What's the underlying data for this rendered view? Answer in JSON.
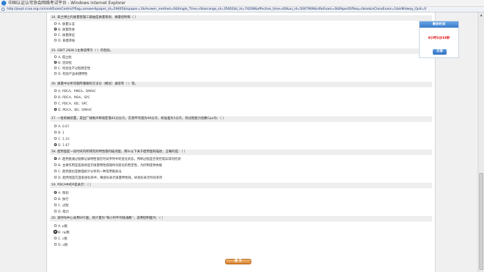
{
  "window": {
    "title": "中国认证认可协会网络考试平台 - Windows Internet Explorer",
    "url": "http://pxpt.ccaa.org.cn/cmd/ExamControl?flag=answer&paper_id=29405&ispaper=1&Answer_method=0&Single_Time=0&arrange_id=35602&t_id=74208&effective_time=60&us_id=5047969&isReExam=0&PaperDifSeq=false&isCloseExam=1&isMidway_Quit=0"
  },
  "questions": [
    {
      "title": "14. 朱兰博士的质量管理三部曲是质量策划、质量控制和（ ）",
      "options": [
        {
          "text": "A. 质量认证",
          "selected": false
        },
        {
          "text": "B. 质量改进",
          "selected": true
        },
        {
          "text": "C. 质量保证",
          "selected": false
        },
        {
          "text": "D. 质量审核",
          "selected": false
        }
      ]
    },
    {
      "title": "15. GB/T 2828.1主要适用于（ ）的检验。",
      "options": [
        {
          "text": "A. 孤立批",
          "selected": false
        },
        {
          "text": "B. 连续批",
          "selected": true
        },
        {
          "text": "C. 检验生产过程稳定性",
          "selected": false
        },
        {
          "text": "D. 检验产品关键特性",
          "selected": false
        }
      ]
    },
    {
      "title": "16. 质量中分析问题所遵循的方法论（模式）通常有（ ）等。",
      "options": [
        {
          "text": "A. PDCA、PMEA、DMAIC",
          "selected": false
        },
        {
          "text": "B. PDCA、MSA、SPC",
          "selected": false
        },
        {
          "text": "C. PDCA、8D、SPC",
          "selected": false
        },
        {
          "text": "D. PDCA、8D、DMAIC",
          "selected": true
        }
      ]
    },
    {
      "title": "17. 一批机械装置，其出厂规格声称规定值42分分贝，实测平均值为46分贝，标准差为1分贝，则过程能力指数Cpu为：（ ）",
      "options": [
        {
          "text": "A. 0.67",
          "selected": false
        },
        {
          "text": "B. 1",
          "selected": false
        },
        {
          "text": "C. 1.33",
          "selected": false
        },
        {
          "text": "D. 1.67",
          "selected": true
        }
      ]
    },
    {
      "title": "18. 趋势图是一段时间内所研究的特性值的描点图，那么以下关于趋势图的描述，正确的是：（ ）",
      "options": [
        {
          "text": "A. 趋势图通过观察记录特性值在时间序列中的变化状态，判断过程是否受控或异常的检测",
          "selected": true
        },
        {
          "text": "B. 主要作用是直观地显示质量特性值随时间变化的稳定性，为控制提供依据",
          "selected": false
        },
        {
          "text": "C. 趋势图也是数理统计分析的一种常用图表法",
          "selected": false
        },
        {
          "text": "D. 趋势图是在直角坐标系中，横坐标表示质量特性值，纵坐标表示时间系列",
          "selected": false
        }
      ]
    },
    {
      "title": "19. PDCA中的P是表示：（ ）",
      "options": [
        {
          "text": "A. 策划",
          "selected": true
        },
        {
          "text": "B. 执行",
          "selected": false
        },
        {
          "text": "C. 过程",
          "selected": false
        },
        {
          "text": "D. 能力",
          "selected": false
        }
      ]
    },
    {
      "title": "20. 某呼叫中心采用SPC图，统计量为“每小时平均接通数”，适用控制图为：（ ）",
      "options": [
        {
          "text": "A. p图",
          "selected": false
        },
        {
          "text": "B. np图",
          "selected": true
        },
        {
          "text": "C. c图",
          "selected": false
        },
        {
          "text": "D. u图",
          "selected": false
        }
      ]
    }
  ],
  "submit_label": "提 交",
  "timer": {
    "heading": "剩余时间",
    "remaining": "0小时1分33秒",
    "submit_label": "交卷"
  }
}
